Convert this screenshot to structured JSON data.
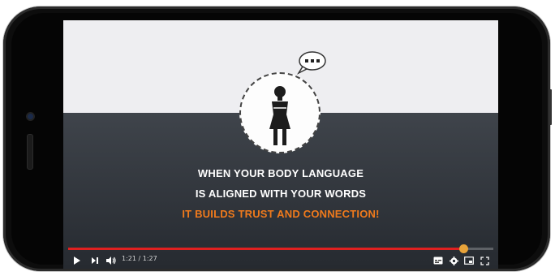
{
  "video": {
    "lines": [
      "WHEN YOUR BODY LANGUAGE",
      "IS ALIGNED WITH YOUR WORDS",
      "IT BUILDS TRUST AND CONNECTION!"
    ],
    "accent_color": "#f07a1c"
  },
  "player": {
    "time_display": "1:21 / 1:27",
    "progress": 0.93,
    "progress_color": "#e02020",
    "icons": [
      "play-icon",
      "next-icon",
      "volume-icon",
      "subtitles-icon",
      "settings-icon",
      "miniplayer-icon",
      "fullscreen-icon"
    ]
  }
}
